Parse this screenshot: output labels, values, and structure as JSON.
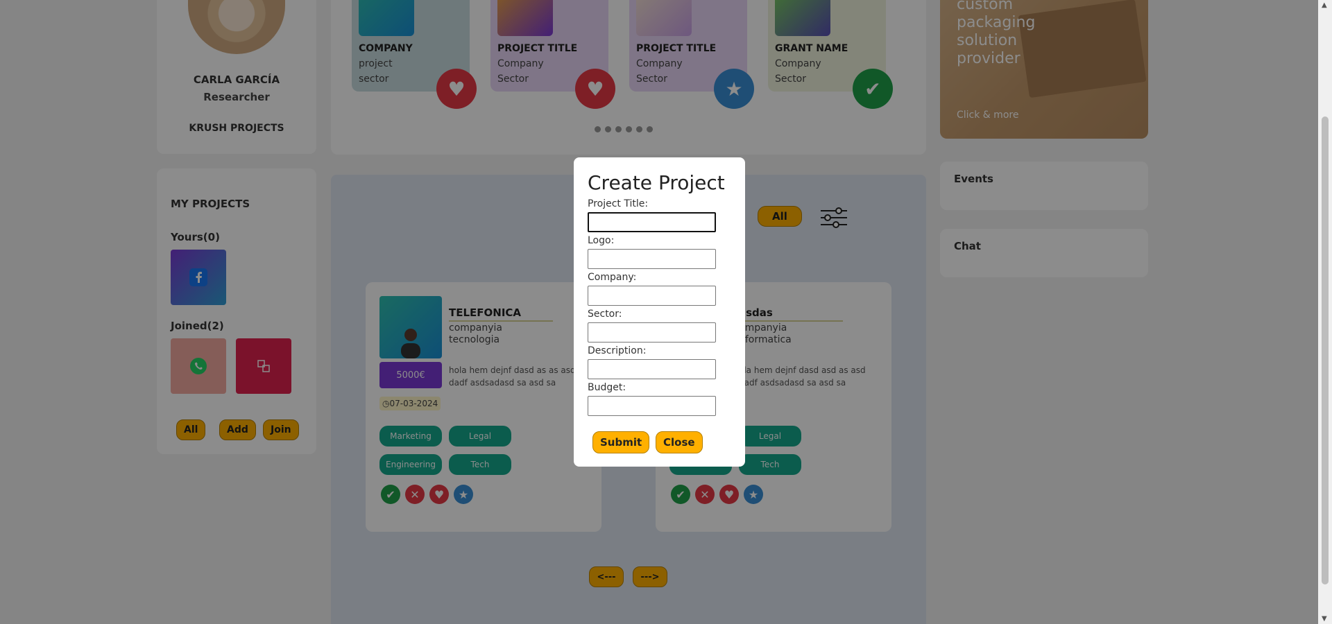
{
  "profile": {
    "name": "CARLA GARCÍA",
    "role": "Researcher",
    "projects_label": "KRUSH PROJECTS"
  },
  "featured": {
    "cards": [
      {
        "title": "COMPANY",
        "line1": "project",
        "line2": "sector",
        "action_icon": "heart-icon",
        "bg": "#c9dde0",
        "accent": "#e63946"
      },
      {
        "title": "PROJECT TITLE",
        "line1": "Company",
        "line2": "Sector",
        "action_icon": "heart-icon",
        "bg": "#e8d6f6",
        "accent": "#e63946"
      },
      {
        "title": "PROJECT TITLE",
        "line1": "Company",
        "line2": "Sector",
        "action_icon": "star-icon",
        "bg": "#e8d6f6",
        "accent": "#3a8fd6"
      },
      {
        "title": "GRANT NAME",
        "line1": "Company",
        "line2": "Sector",
        "action_icon": "check-icon",
        "bg": "#eef2dc",
        "accent": "#20a04a"
      }
    ]
  },
  "ad": {
    "text": "custom packaging solution provider",
    "link": "Click & more"
  },
  "side": {
    "events": "Events",
    "chat": "Chat"
  },
  "my_projects": {
    "title": "MY PROJECTS",
    "yours": "Yours(0)",
    "joined": "Joined(2)",
    "buttons": {
      "all": "All",
      "add": "Add",
      "join": "Join"
    }
  },
  "feed": {
    "filter_all": "All",
    "cards": [
      {
        "title": "TELEFONICA",
        "line1": "companyia",
        "line2": "tecnologia",
        "desc": "hola hem dejnf dasd as as asd dadf asdsadasd sa asd sa",
        "budget": "5000€",
        "date": "07-03-2024",
        "tags": [
          "Marketing",
          "Legal",
          "Engineering",
          "Tech"
        ]
      },
      {
        "title": "asdas",
        "line1": "ompanyia",
        "line2": "nformatica",
        "desc": "ola hem dejnf dasd asd as asd dadf asdsadasd sa asd sa",
        "budget": "",
        "date": "",
        "tags": [
          "",
          "Legal",
          "",
          "Tech"
        ]
      }
    ],
    "prev": "<---",
    "next": "--->"
  },
  "modal": {
    "title": "Create Project",
    "fields": {
      "project_title": "Project Title:",
      "logo": "Logo:",
      "company": "Company:",
      "sector": "Sector:",
      "description": "Description:",
      "budget": "Budget:"
    },
    "submit": "Submit",
    "close": "Close"
  }
}
